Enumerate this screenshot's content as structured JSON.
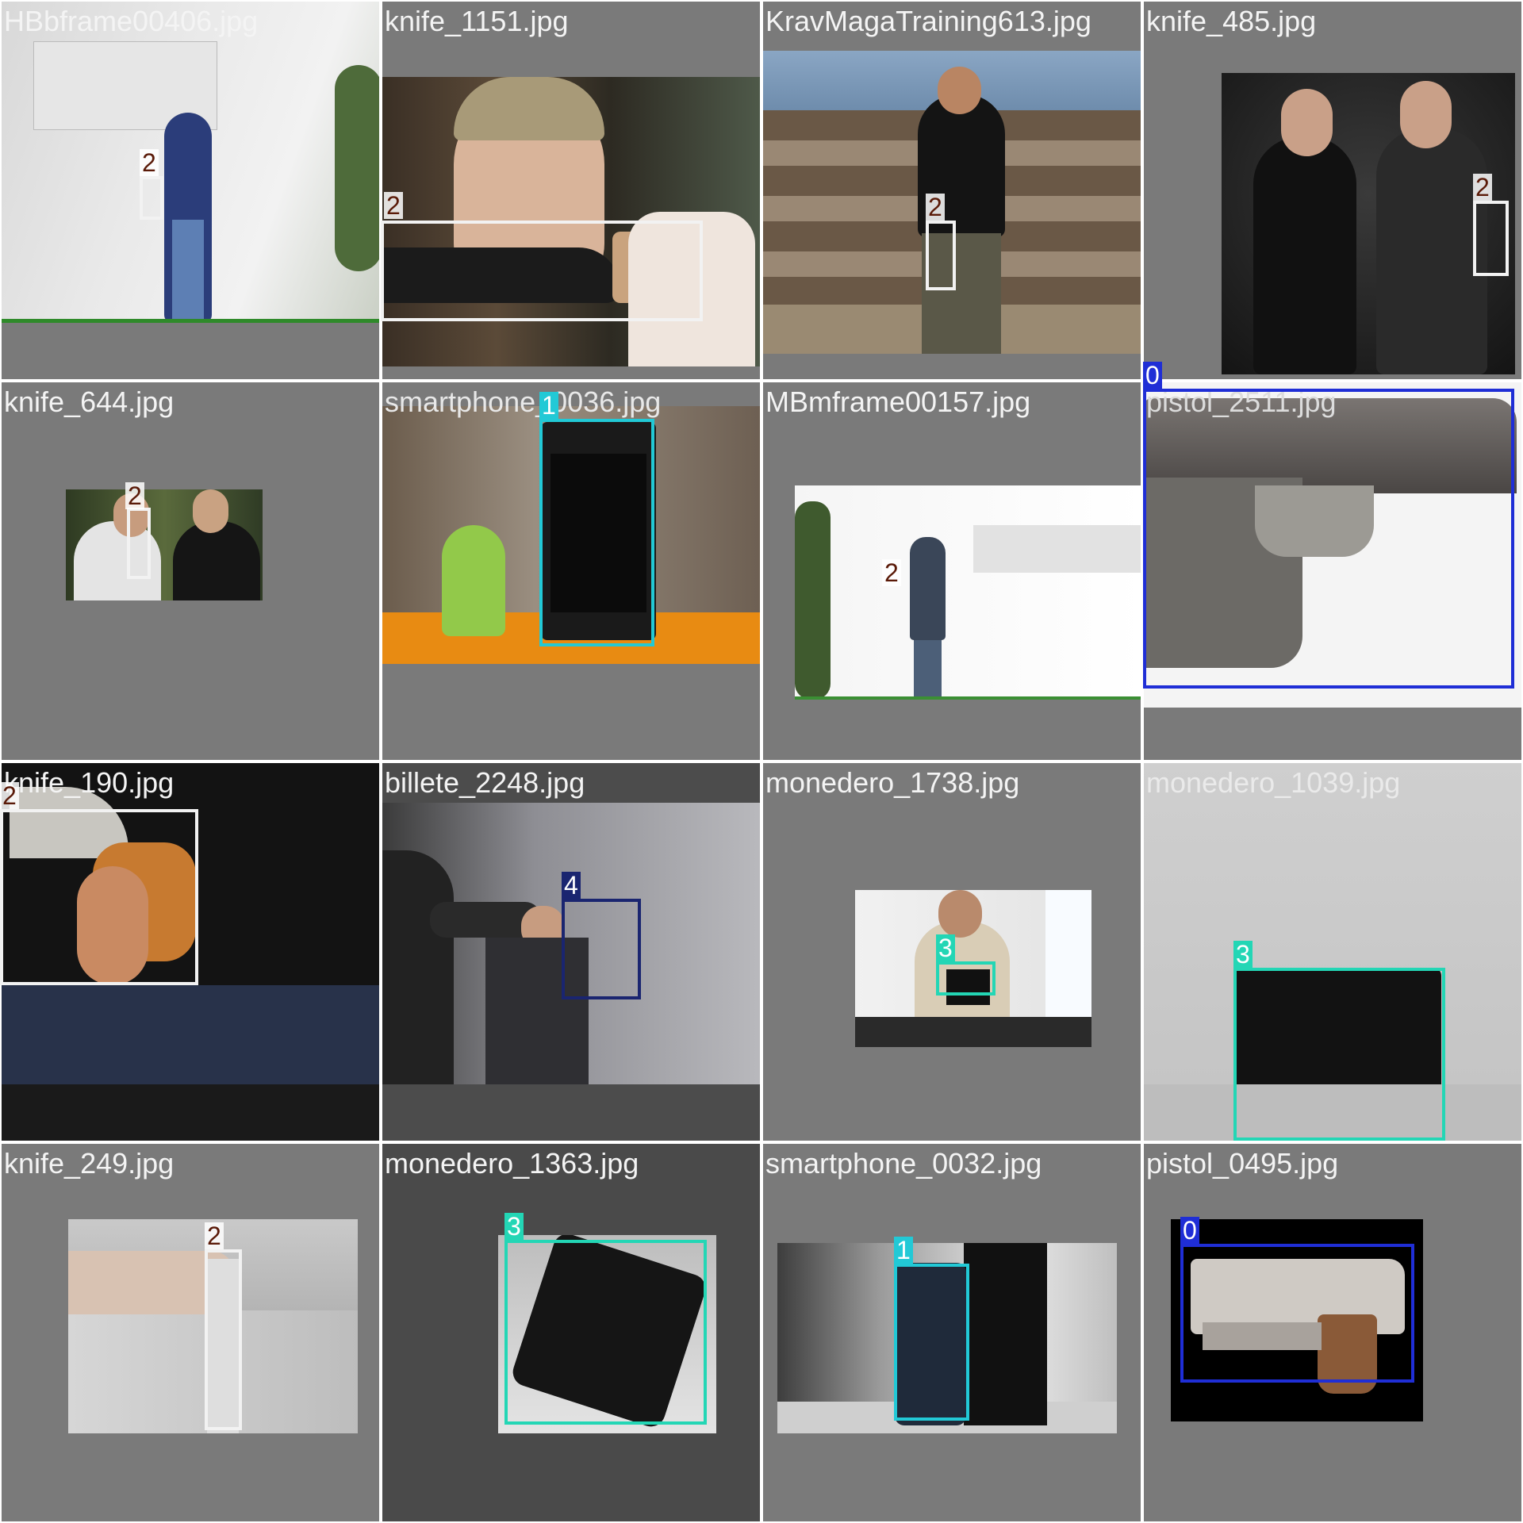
{
  "grid": {
    "columns": 4,
    "rows": 4
  },
  "classes": {
    "0": {
      "label": "0",
      "color": "#1f2ed6",
      "label_text_color": "#ffffff"
    },
    "1": {
      "label": "1",
      "color": "#22c9d6",
      "label_text_color": "#ffffff"
    },
    "2": {
      "label": "2",
      "color": "#f2f2f2",
      "label_text_color": "#5a1a08"
    },
    "3": {
      "label": "3",
      "color": "#23d6b5",
      "label_text_color": "#ffffff"
    },
    "4": {
      "label": "4",
      "color": "#1a2570",
      "label_text_color": "#ffffff"
    }
  },
  "tiles": [
    {
      "filename": "HBbframe00406.jpg",
      "scene": "man-standing-at-wall",
      "name_color": "#f4f4f4",
      "detections": [
        {
          "class": "2"
        }
      ]
    },
    {
      "filename": "knife_1151.jpg",
      "scene": "man-holding-knife",
      "name_color": "#f4f4f4",
      "detections": [
        {
          "class": "2"
        }
      ]
    },
    {
      "filename": "KravMagaTraining613.jpg",
      "scene": "man-at-fence-with-knife",
      "name_color": "#f4f4f4",
      "detections": [
        {
          "class": "2"
        }
      ]
    },
    {
      "filename": "knife_485.jpg",
      "scene": "handshake-knives-behind-back",
      "name_color": "#f4f4f4",
      "detections": [
        {
          "class": "2"
        }
      ]
    },
    {
      "filename": "knife_644.jpg",
      "scene": "two-men-outdoors",
      "name_color": "#f4f4f4",
      "detections": [
        {
          "class": "2"
        }
      ]
    },
    {
      "filename": "smartphone_0036.jpg",
      "scene": "android-figure-and-phone",
      "name_color": "#e8e8e8",
      "detections": [
        {
          "class": "1"
        }
      ]
    },
    {
      "filename": "MBmframe00157.jpg",
      "scene": "man-walking-in-room",
      "name_color": "#f4f4f4",
      "detections": [
        {
          "class": "2"
        }
      ]
    },
    {
      "filename": "pistol_2511.jpg",
      "scene": "pistol-closeup",
      "name_color": "#dcdcdc",
      "detections": [
        {
          "class": "0"
        }
      ]
    },
    {
      "filename": "knife_190.jpg",
      "scene": "hand-with-knife-behind-back",
      "name_color": "#f4f4f4",
      "detections": [
        {
          "class": "2"
        }
      ]
    },
    {
      "filename": "billete_2248.jpg",
      "scene": "hand-holding-banknote",
      "name_color": "#f4f4f4",
      "detections": [
        {
          "class": "4"
        }
      ]
    },
    {
      "filename": "monedero_1738.jpg",
      "scene": "man-holding-wallet",
      "name_color": "#f4f4f4",
      "detections": [
        {
          "class": "3"
        }
      ]
    },
    {
      "filename": "monedero_1039.jpg",
      "scene": "black-wallet-product",
      "name_color": "#eaeaea",
      "detections": [
        {
          "class": "3"
        }
      ]
    },
    {
      "filename": "knife_249.jpg",
      "scene": "knife-held-at-side",
      "name_color": "#f4f4f4",
      "detections": [
        {
          "class": "2"
        }
      ]
    },
    {
      "filename": "monedero_1363.jpg",
      "scene": "black-leather-wallet",
      "name_color": "#f4f4f4",
      "detections": [
        {
          "class": "3"
        }
      ]
    },
    {
      "filename": "smartphone_0032.jpg",
      "scene": "galaxy-s7-and-box",
      "name_color": "#f4f4f4",
      "detections": [
        {
          "class": "1"
        }
      ]
    },
    {
      "filename": "pistol_0495.jpg",
      "scene": "desert-eagle-pistol",
      "name_color": "#f4f4f4",
      "detections": [
        {
          "class": "0"
        }
      ]
    }
  ]
}
